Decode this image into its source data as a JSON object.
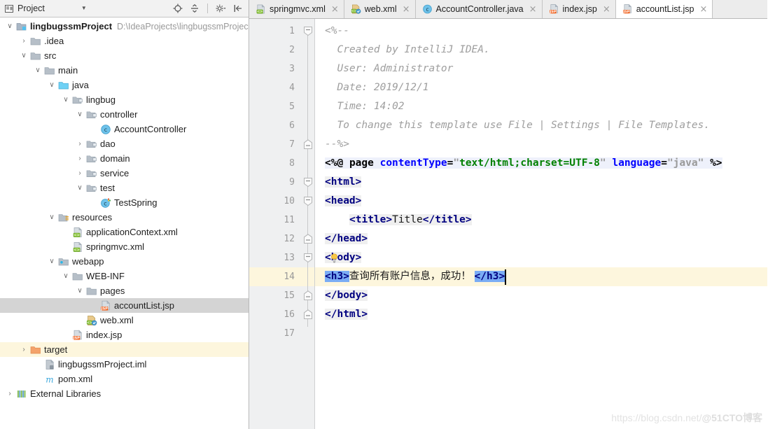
{
  "panel": {
    "title": "Project",
    "icon": "project-view-icon",
    "dropdown_icon": "chevron-down-icon",
    "tools": [
      {
        "name": "locate-icon",
        "title": "Select Opened File"
      },
      {
        "name": "collapse-all-icon",
        "title": "Collapse All"
      },
      {
        "name": "settings-gear-icon",
        "title": "Settings"
      },
      {
        "name": "hide-panel-icon",
        "title": "Hide"
      }
    ]
  },
  "tree": [
    {
      "indent": 0,
      "twisty": "∨",
      "icon": "module-folder-icon",
      "label": "lingbugssmProject",
      "bold": true,
      "path": "D:\\IdeaProjects\\lingbugssmProjec",
      "state": "none"
    },
    {
      "indent": 1,
      "twisty": "›",
      "icon": "folder-gray-icon",
      "label": ".idea",
      "bold": false,
      "path": "",
      "state": "none"
    },
    {
      "indent": 1,
      "twisty": "∨",
      "icon": "folder-gray-icon",
      "label": "src",
      "bold": false,
      "path": "",
      "state": "none"
    },
    {
      "indent": 2,
      "twisty": "∨",
      "icon": "folder-gray-icon",
      "label": "main",
      "bold": false,
      "path": "",
      "state": "none"
    },
    {
      "indent": 3,
      "twisty": "∨",
      "icon": "folder-source-icon",
      "label": "java",
      "bold": false,
      "path": "",
      "state": "none"
    },
    {
      "indent": 4,
      "twisty": "∨",
      "icon": "package-icon",
      "label": "lingbug",
      "bold": false,
      "path": "",
      "state": "none"
    },
    {
      "indent": 5,
      "twisty": "∨",
      "icon": "package-icon",
      "label": "controller",
      "bold": false,
      "path": "",
      "state": "none"
    },
    {
      "indent": 6,
      "twisty": "",
      "icon": "java-class-icon",
      "label": "AccountController",
      "bold": false,
      "path": "",
      "state": "none"
    },
    {
      "indent": 5,
      "twisty": "›",
      "icon": "package-icon",
      "label": "dao",
      "bold": false,
      "path": "",
      "state": "none"
    },
    {
      "indent": 5,
      "twisty": "›",
      "icon": "package-icon",
      "label": "domain",
      "bold": false,
      "path": "",
      "state": "none"
    },
    {
      "indent": 5,
      "twisty": "›",
      "icon": "package-icon",
      "label": "service",
      "bold": false,
      "path": "",
      "state": "none"
    },
    {
      "indent": 5,
      "twisty": "∨",
      "icon": "package-icon",
      "label": "test",
      "bold": false,
      "path": "",
      "state": "none"
    },
    {
      "indent": 6,
      "twisty": "",
      "icon": "java-test-class-icon",
      "label": "TestSpring",
      "bold": false,
      "path": "",
      "state": "none"
    },
    {
      "indent": 3,
      "twisty": "∨",
      "icon": "folder-resources-icon",
      "label": "resources",
      "bold": false,
      "path": "",
      "state": "none"
    },
    {
      "indent": 4,
      "twisty": "",
      "icon": "xml-file-icon",
      "label": "applicationContext.xml",
      "bold": false,
      "path": "",
      "state": "none"
    },
    {
      "indent": 4,
      "twisty": "",
      "icon": "xml-file-icon",
      "label": "springmvc.xml",
      "bold": false,
      "path": "",
      "state": "none"
    },
    {
      "indent": 3,
      "twisty": "∨",
      "icon": "folder-webapp-icon",
      "label": "webapp",
      "bold": false,
      "path": "",
      "state": "none"
    },
    {
      "indent": 4,
      "twisty": "∨",
      "icon": "folder-gray-icon",
      "label": "WEB-INF",
      "bold": false,
      "path": "",
      "state": "none"
    },
    {
      "indent": 5,
      "twisty": "∨",
      "icon": "folder-gray-icon",
      "label": "pages",
      "bold": false,
      "path": "",
      "state": "none"
    },
    {
      "indent": 6,
      "twisty": "",
      "icon": "jsp-file-icon",
      "label": "accountList.jsp",
      "bold": false,
      "path": "",
      "state": "selected"
    },
    {
      "indent": 5,
      "twisty": "",
      "icon": "web-xml-icon",
      "label": "web.xml",
      "bold": false,
      "path": "",
      "state": "none"
    },
    {
      "indent": 4,
      "twisty": "",
      "icon": "jsp-file-icon",
      "label": "index.jsp",
      "bold": false,
      "path": "",
      "state": "none"
    },
    {
      "indent": 1,
      "twisty": "›",
      "icon": "folder-orange-icon",
      "label": "target",
      "bold": false,
      "path": "",
      "state": "highlight"
    },
    {
      "indent": 2,
      "twisty": "",
      "icon": "iml-file-icon",
      "label": "lingbugssmProject.iml",
      "bold": false,
      "path": "",
      "state": "none"
    },
    {
      "indent": 2,
      "twisty": "",
      "icon": "maven-pom-icon",
      "label": "pom.xml",
      "bold": false,
      "path": "",
      "state": "none"
    },
    {
      "indent": 0,
      "twisty": "›",
      "icon": "external-libraries-icon",
      "label": "External Libraries",
      "bold": false,
      "path": "",
      "state": "none"
    }
  ],
  "tabs": [
    {
      "label": "springmvc.xml",
      "icon": "xml-file-icon",
      "active": false,
      "close_icon": "close-icon"
    },
    {
      "label": "web.xml",
      "icon": "web-xml-icon",
      "active": false,
      "close_icon": "close-icon"
    },
    {
      "label": "AccountController.java",
      "icon": "java-class-icon",
      "active": false,
      "close_icon": "close-icon"
    },
    {
      "label": "index.jsp",
      "icon": "jsp-file-icon",
      "active": false,
      "close_icon": "close-icon"
    },
    {
      "label": "accountList.jsp",
      "icon": "jsp-file-icon",
      "active": true,
      "close_icon": "close-icon"
    }
  ],
  "editor": {
    "current_line": 14,
    "line_numbers": [
      "1",
      "2",
      "3",
      "4",
      "5",
      "6",
      "7",
      "8",
      "9",
      "10",
      "11",
      "12",
      "13",
      "14",
      "15",
      "16",
      "17"
    ],
    "lines": [
      {
        "n": 1,
        "text": "<%--"
      },
      {
        "n": 2,
        "text": "  Created by IntelliJ IDEA."
      },
      {
        "n": 3,
        "text": "  User: Administrator"
      },
      {
        "n": 4,
        "text": "  Date: 2019/12/1"
      },
      {
        "n": 5,
        "text": "  Time: 14:02"
      },
      {
        "n": 6,
        "text": "  To change this template use File | Settings | File Templates."
      },
      {
        "n": 7,
        "text": "--%>"
      },
      {
        "n": 8,
        "text": "<%@ page contentType=\"text/html;charset=UTF-8\" language=\"java\" %>"
      },
      {
        "n": 9,
        "text": "<html>"
      },
      {
        "n": 10,
        "text": "<head>"
      },
      {
        "n": 11,
        "text": "    <title>Title</title>"
      },
      {
        "n": 12,
        "text": "</head>"
      },
      {
        "n": 13,
        "text": "<body>"
      },
      {
        "n": 14,
        "text": "<h3>查询所有账户信息，成功！</h3>"
      },
      {
        "n": 15,
        "text": "</body>"
      },
      {
        "n": 16,
        "text": "</html>"
      },
      {
        "n": 17,
        "text": ""
      }
    ],
    "tokens": {
      "l1_comment": "<%--",
      "l2_comment": "Created by IntelliJ IDEA.",
      "l3_comment": "User: Administrator",
      "l4_comment": "Date: 2019/12/1",
      "l5_comment": "Time: 14:02",
      "l6_comment": "To change this template use File | Settings | File Templates.",
      "l7_comment": "--%>",
      "l8_open": "<%@",
      "l8_page": "page",
      "l8_attr1": "contentType",
      "l8_eq1": "=",
      "l8_q1": "\"",
      "l8_val1": "text/html;charset=UTF-8",
      "l8_q2": "\"",
      "l8_attr2": "language",
      "l8_eq2": "=",
      "l8_q3": "\"",
      "l8_val2": "java",
      "l8_q4": "\"",
      "l8_close": "%>",
      "l9_html": "<html>",
      "l10_head": "<head>",
      "l11_title_open": "<title>",
      "l11_title_text": "Title",
      "l11_title_close": "</title>",
      "l12_head_close": "</head>",
      "l13_body": "<body>",
      "l14_h3_open": "<h3>",
      "l14_text": "查询所有账户信息，成功！ ",
      "l14_h3_close": "</h3>",
      "l15_body_close": "</body>",
      "l16_html_close": "</html>"
    }
  },
  "watermark": {
    "url": "https://blog.csdn.net/",
    "tag": "@51CTO博客"
  },
  "colors": {
    "tag": "#000080",
    "attr": "#0000ff",
    "string": "#008000",
    "comment": "#9e9e9e",
    "current_line": "#fdf6dd",
    "brace_match": "#7aacf5",
    "selection_gray": "#d4d4d4"
  }
}
